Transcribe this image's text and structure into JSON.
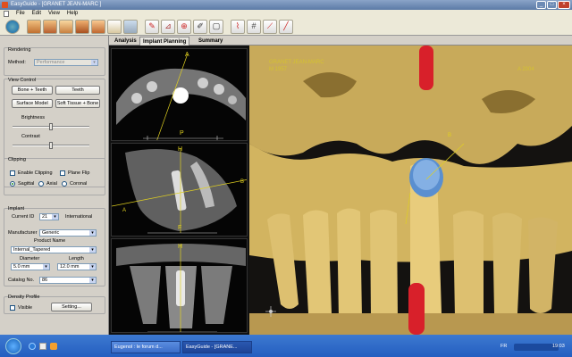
{
  "window": {
    "title": "EasyGuide - [GRANET JEAN-MARC ]"
  },
  "menu": [
    "File",
    "Edit",
    "View",
    "Help"
  ],
  "toolbar_icons": [
    "help-icon",
    "head-view-icon",
    "face-view-icon",
    "skull-view-icon",
    "bone-view-icon",
    "jaw-view-icon",
    "tooth-view-icon",
    "screen-icon",
    "implant-tool-icon",
    "ruler-icon",
    "crosshair-icon",
    "pencil-icon",
    "square-icon",
    "nerve-tool-icon",
    "grid-icon",
    "measure-icon",
    "line-icon"
  ],
  "tabs": [
    "Analysis",
    "Implant Planning",
    "Summary"
  ],
  "rendering": {
    "group": "Rendering",
    "method_label": "Method:",
    "method_value": "Performance"
  },
  "view_control": {
    "group": "View Control",
    "bone_teeth": "Bone + Teeth",
    "teeth": "Teeth",
    "surface_model": "Surface Model",
    "soft_tissue_bone": "Soft Tissue + Bone",
    "brightness": "Brightness",
    "contrast": "Contrast",
    "brightness_level": 0.5,
    "contrast_level": 0.5
  },
  "clipping": {
    "group": "Clipping",
    "enable_clipping": "Enable Clipping",
    "plane_flip": "Plane Flip",
    "sagittal": "Sagittal",
    "axial": "Axial",
    "coronal": "Coronal"
  },
  "implant": {
    "group": "Implant",
    "current_id_label": "Current ID",
    "current_id": "21",
    "international": "International",
    "manufacturer_label": "Manufacturer",
    "manufacturer": "Generic",
    "product_label": "Product Name",
    "product": "Internal_Tapered",
    "diameter_label": "Diameter",
    "diameter": "5.0 mm",
    "length_label": "Length",
    "length": "12.0 mm",
    "catalog_label": "Catalog No.",
    "catalog": "86"
  },
  "density": {
    "group": "Density Profile",
    "visible": "Visible",
    "setting": "Setting..."
  },
  "slices": {
    "axial_a": "A",
    "axial_p": "P",
    "sag_h": "H",
    "sag_a": "A",
    "sag_b": "B",
    "sag_f": "F",
    "cor_h": "H"
  },
  "view3d": {
    "patient_text": "GRANET JEAN-MARC",
    "corner_text": "M 1957",
    "right_text": "A 2004",
    "marker": "B"
  },
  "taskbar": {
    "items": [
      "Eugenol : le forum d...",
      "EasyGuide - [GRANE..."
    ],
    "lang": "FR",
    "clock": "19:03"
  }
}
